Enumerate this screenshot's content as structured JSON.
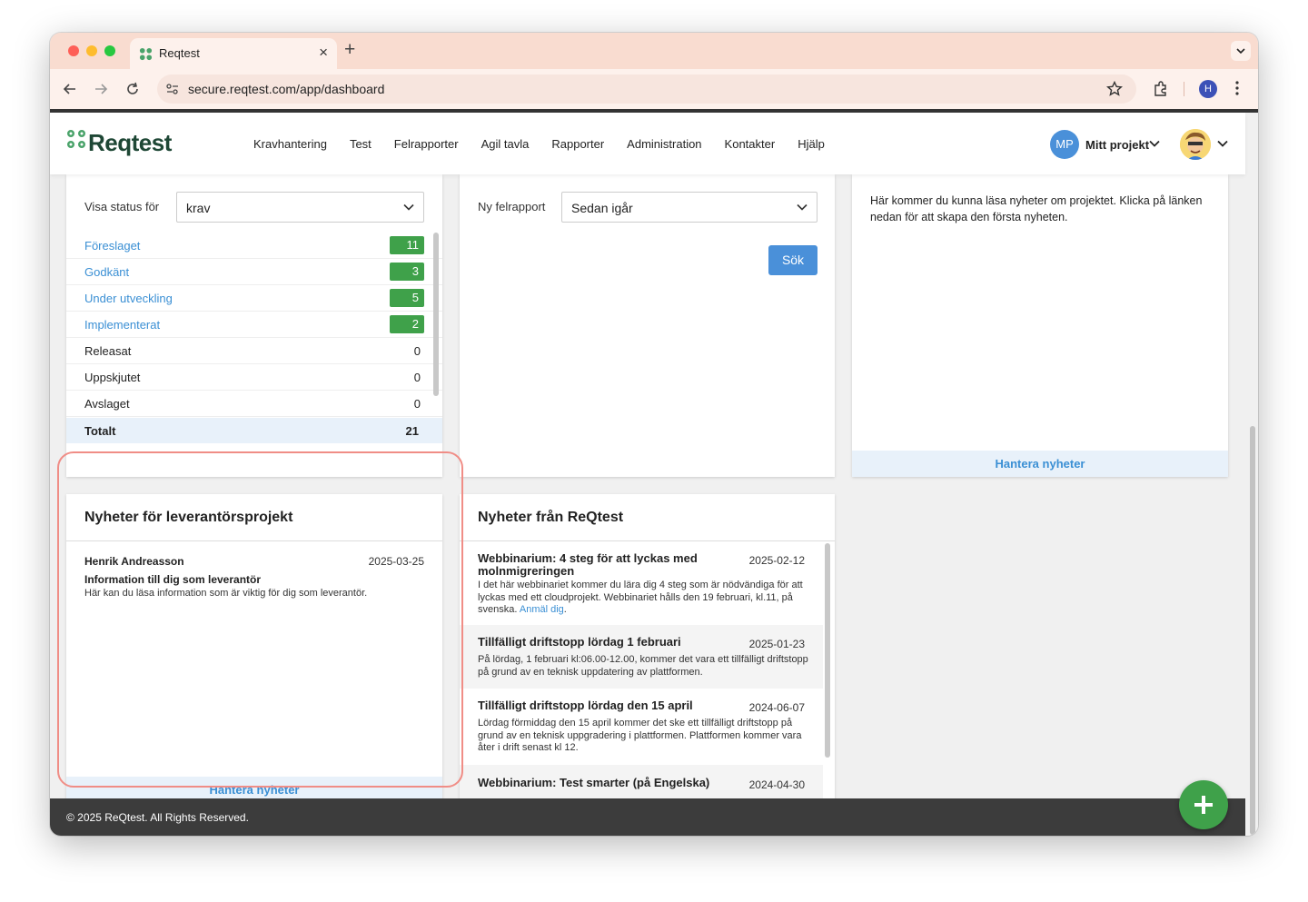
{
  "browser": {
    "tab_title": "Reqtest",
    "tab_close": "×",
    "new_tab": "+",
    "url": "secure.reqtest.com/app/dashboard",
    "profile_initial": "H"
  },
  "app": {
    "logo_text": "Reqtest",
    "nav": [
      "Kravhantering",
      "Test",
      "Felrapporter",
      "Agil tavla",
      "Rapporter",
      "Administration",
      "Kontakter",
      "Hjälp"
    ],
    "project_initials": "MP",
    "project_label": "Mitt projekt"
  },
  "status_card": {
    "label": "Visa status för",
    "select_value": "krav",
    "rows": [
      {
        "label": "Föreslaget",
        "count": "11",
        "linked": true
      },
      {
        "label": "Godkänt",
        "count": "3",
        "linked": true
      },
      {
        "label": "Under utveckling",
        "count": "5",
        "linked": true
      },
      {
        "label": "Implementerat",
        "count": "2",
        "linked": true
      },
      {
        "label": "Releasat",
        "count": "0",
        "linked": false
      },
      {
        "label": "Uppskjutet",
        "count": "0",
        "linked": false
      },
      {
        "label": "Avslaget",
        "count": "0",
        "linked": false
      }
    ],
    "total_label": "Totalt",
    "total_value": "21"
  },
  "bug_card": {
    "label": "Ny felrapport",
    "select_value": "Sedan igår",
    "search_button": "Sök"
  },
  "project_news_card": {
    "body": "Här kommer du kunna läsa nyheter om projektet. Klicka på länken nedan för att skapa den första nyheten.",
    "footer_link": "Hantera nyheter"
  },
  "supplier_news_card": {
    "title": "Nyheter för leverantörsprojekt",
    "author": "Henrik Andreasson",
    "date": "2025-03-25",
    "item_title": "Information till dig som leverantör",
    "item_body": "Här kan du läsa information som är viktig för dig som leverantör.",
    "footer_link": "Hantera nyheter"
  },
  "reqtest_news_card": {
    "title": "Nyheter från ReQtest",
    "items": [
      {
        "title": "Webbinarium: 4 steg för att lyckas med molnmigreringen",
        "date": "2025-02-12",
        "body": "I det här webbinariet kommer du lära dig 4 steg som är nödvändiga för att lyckas med ett cloudprojekt. Webbinariet hålls den 19 februari, kl.11, på svenska. ",
        "link": "Anmäl dig",
        "tail": "."
      },
      {
        "title": "Tillfälligt driftstopp lördag 1 februari",
        "date": "2025-01-23",
        "body": "På lördag, 1 februari kl:06.00-12.00, kommer det vara ett tillfälligt driftstopp på grund av en teknisk uppdatering av plattformen."
      },
      {
        "title": "Tillfälligt driftstopp lördag den 15 april",
        "date": "2024-06-07",
        "body": "Lördag förmiddag den 15 april kommer det ske ett tillfälligt driftstopp på grund av en teknisk uppgradering i plattformen. Plattformen kommer vara åter i drift senast kl 12."
      },
      {
        "title": "Webbinarium: Test smarter (på Engelska)",
        "date": "2024-04-30",
        "body": ""
      }
    ]
  },
  "footer": {
    "copyright": "© 2025 ReQtest. All Rights Reserved."
  },
  "colors": {
    "accent_blue": "#4a90d9",
    "badge_green": "#3fa14a",
    "link_blue": "#3a8fd4",
    "highlight": "#f08d86",
    "tab_strip": "#f9dcd0"
  }
}
